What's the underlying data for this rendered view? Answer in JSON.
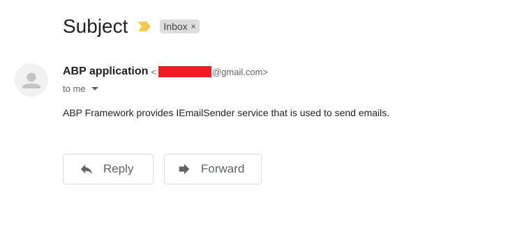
{
  "header": {
    "subject": "Subject",
    "importance_icon": "importance-marker-icon",
    "label": {
      "text": "Inbox",
      "remove_symbol": "×"
    }
  },
  "message": {
    "sender_name": "ABP application",
    "email_open": "<",
    "email_domain": "@gmail.com>",
    "recipient_text": "to me",
    "body": "ABP Framework provides IEmailSender service that is used to send emails."
  },
  "actions": {
    "reply_label": "Reply",
    "forward_label": "Forward"
  },
  "colors": {
    "redaction": "#ee1c25",
    "importance": "#f2c94c",
    "chip_background": "#dddddd"
  }
}
